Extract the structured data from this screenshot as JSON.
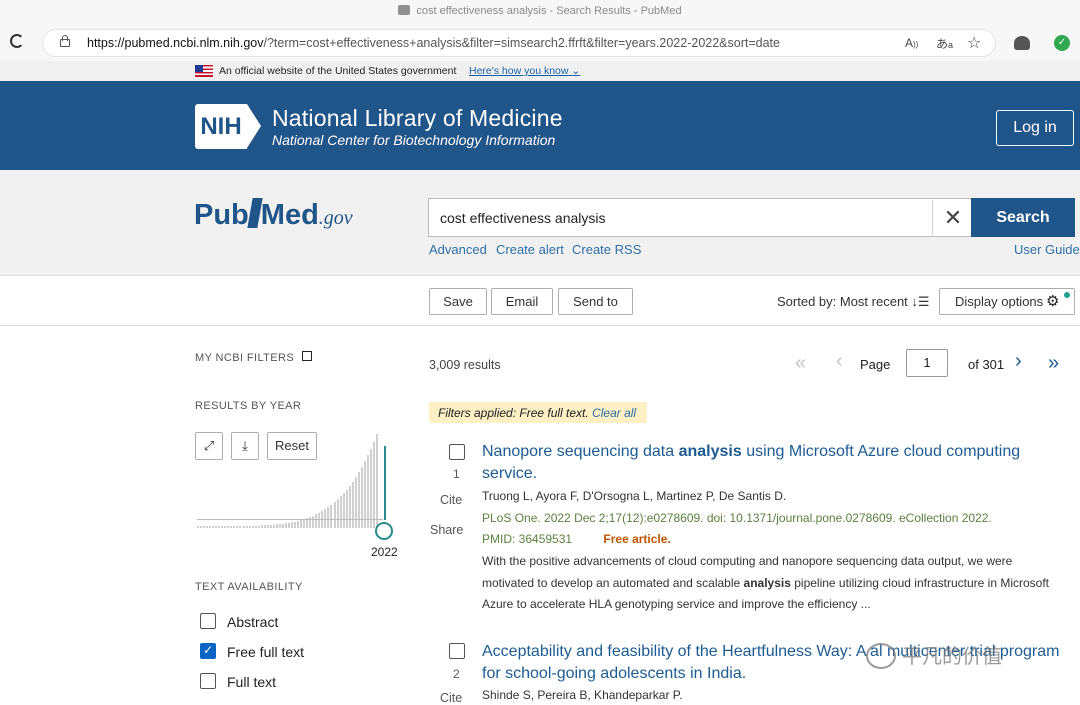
{
  "browser": {
    "tab_title": "cost effectiveness analysis - Search Results - PubMed",
    "url_host": "https://pubmed.ncbi.nlm.nih.gov",
    "url_rest": "/?term=cost+effectiveness+analysis&filter=simsearch2.ffrft&filter=years.2022-2022&sort=date",
    "icons": [
      "refresh-icon",
      "lock-icon",
      "read-aloud-icon",
      "translate-icon",
      "favorites-add-icon",
      "extension-icon",
      "profile-icon"
    ]
  },
  "gov_banner": {
    "text": "An official website of the United States government",
    "link": "Here's how you know"
  },
  "header": {
    "logo_text": "NIH",
    "title": "National Library of Medicine",
    "subtitle": "National Center for Biotechnology Information",
    "login": "Log in"
  },
  "search": {
    "logo_pub": "Pub",
    "logo_med": "Med",
    "logo_gov": ".gov",
    "query": "cost effectiveness analysis",
    "button": "Search",
    "links": [
      "Advanced",
      "Create alert",
      "Create RSS"
    ],
    "user_guide": "User Guide"
  },
  "toolbar": {
    "save": "Save",
    "email": "Email",
    "send_to": "Send to",
    "sorted_by": "Sorted by: Most recent",
    "display_options": "Display options"
  },
  "sidebar": {
    "my_ncbi": "MY NCBI FILTERS",
    "results_by_year": "RESULTS BY YEAR",
    "reset": "Reset",
    "year_label": "2022",
    "text_availability": "TEXT AVAILABILITY",
    "filters": [
      {
        "label": "Abstract",
        "checked": false
      },
      {
        "label": "Free full text",
        "checked": true
      },
      {
        "label": "Full text",
        "checked": false
      }
    ]
  },
  "results_bar": {
    "count": "3,009 results",
    "page_label": "Page",
    "page_value": "1",
    "of_pages": "of 301"
  },
  "filters_applied": {
    "text": "Filters applied: Free full text.",
    "clear": "Clear all"
  },
  "results": [
    {
      "num": "1",
      "title_parts": [
        "Nanopore sequencing data ",
        "analysis",
        " using Microsoft Azure cloud computing service."
      ],
      "authors": "Truong L, Ayora F, D'Orsogna L, Martinez P, De Santis D.",
      "citation": "PLoS One. 2022 Dec 2;17(12):e0278609. doi: 10.1371/journal.pone.0278609. eCollection 2022.",
      "pmid": "PMID: 36459531",
      "free": "Free article.",
      "snippet_parts": [
        "With the positive advancements of cloud computing and nanopore sequencing data output, we were motivated to develop an automated and scalable ",
        "analysis",
        " pipeline utilizing cloud infrastructure in Microsoft Azure to accelerate HLA genotyping service and improve the efficiency ..."
      ],
      "cite": "Cite",
      "share": "Share"
    },
    {
      "num": "2",
      "title_parts": [
        "Acceptability and feasibility of the Heartfulness Way: A ",
        "",
        "al multicenter trial program for school-going adolescents in India."
      ],
      "authors": "Shinde S, Pereira B, Khandeparkar P.",
      "cite": "Cite"
    }
  ],
  "watermark": "平凡的价值",
  "colors": {
    "nih_blue": "#20558a",
    "link_blue": "#1d5b93",
    "citation_green": "#5b7f3e",
    "free_orange": "#c05600",
    "filter_bg": "#fdf0c4",
    "checkbox_blue": "#0a66c2",
    "year_bar": "#2b8a8a"
  }
}
